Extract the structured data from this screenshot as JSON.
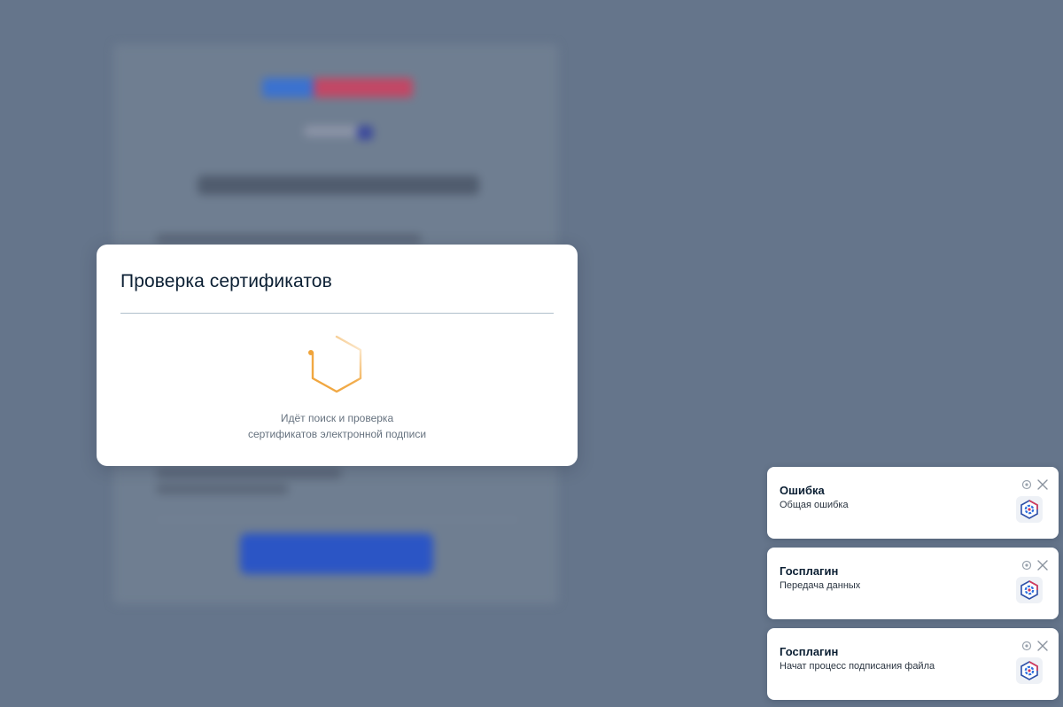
{
  "modal": {
    "title": "Проверка сертификатов",
    "message_line1": "Идёт поиск и проверка",
    "message_line2": "сертификатов электронной подписи"
  },
  "toasts": [
    {
      "title": "Ошибка",
      "message": "Общая ошибка"
    },
    {
      "title": "Госплагин",
      "message": "Передача данных"
    },
    {
      "title": "Госплагин",
      "message": "Начат процесс подписания файла"
    }
  ],
  "colors": {
    "overlay": "#65758b",
    "spinner": "#f0a43a",
    "title": "#0b1f33",
    "logo_blue": "#2d6fe0",
    "logo_red": "#d7395a"
  },
  "icons": {
    "spinner": "hexagon-loader-icon",
    "pin": "pin-icon",
    "close": "close-icon",
    "app_logo": "gosplagin-logo-icon"
  }
}
